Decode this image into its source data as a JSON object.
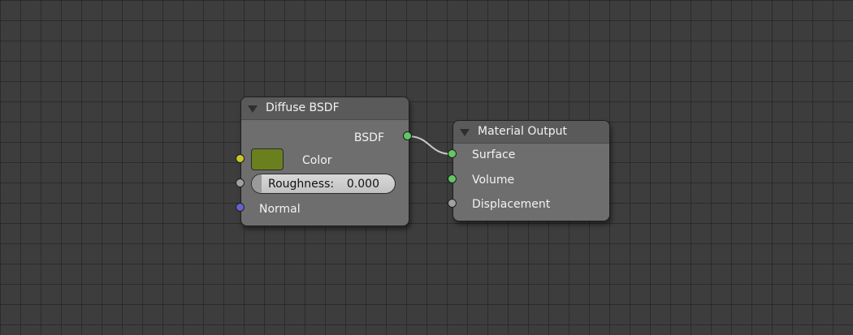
{
  "colors": {
    "background": "#3d3d3d",
    "node_body": "#6e6e6e",
    "node_header": "#5a5a5a",
    "socket_color": "#c7c729",
    "socket_float": "#a1a1a1",
    "socket_vector": "#6363c7",
    "socket_shader": "#63c763",
    "color_swatch": "#6a801f",
    "link": "#c8c8c8"
  },
  "nodes": {
    "diffuse": {
      "title": "Diffuse BSDF",
      "output_label": "BSDF",
      "inputs": {
        "color_label": "Color",
        "roughness_label": "Roughness:",
        "roughness_value": "0.000",
        "normal_label": "Normal"
      }
    },
    "material_output": {
      "title": "Material Output",
      "inputs": {
        "surface_label": "Surface",
        "volume_label": "Volume",
        "displacement_label": "Displacement"
      }
    }
  },
  "icons": {
    "collapse": "triangle-down-icon",
    "socket": "circle-socket-icon"
  }
}
